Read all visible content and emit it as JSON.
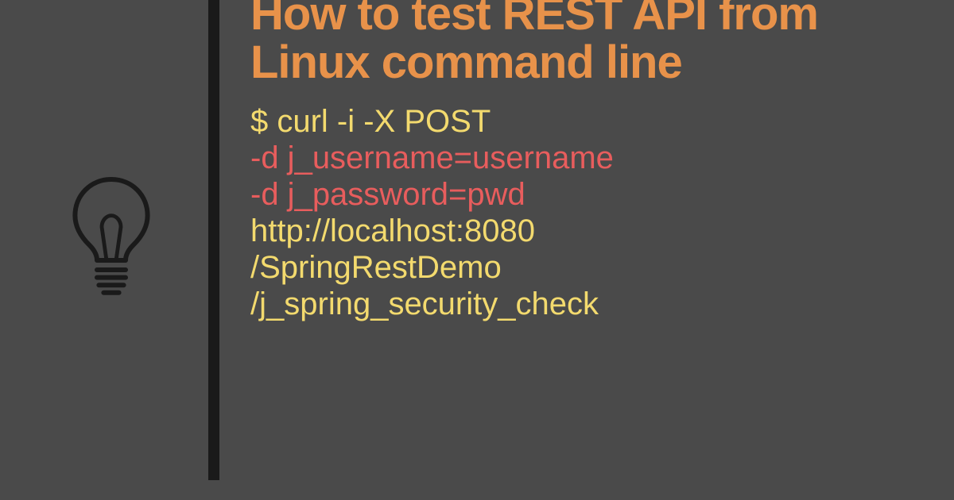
{
  "title": "How to test REST API from Linux command line",
  "icon": "lightbulb-icon",
  "code": {
    "line1": "$ curl -i -X POST",
    "line2": "-d j_username=username",
    "line3": "-d j_password=pwd",
    "line4": " http://localhost:8080",
    "line5": "/SpringRestDemo",
    "line6": "/j_spring_security_check"
  },
  "colors": {
    "background": "#4a4a4a",
    "title": "#e8924a",
    "yellow": "#f3da6e",
    "red": "#e85d5d",
    "bar": "#1a1a1a"
  }
}
